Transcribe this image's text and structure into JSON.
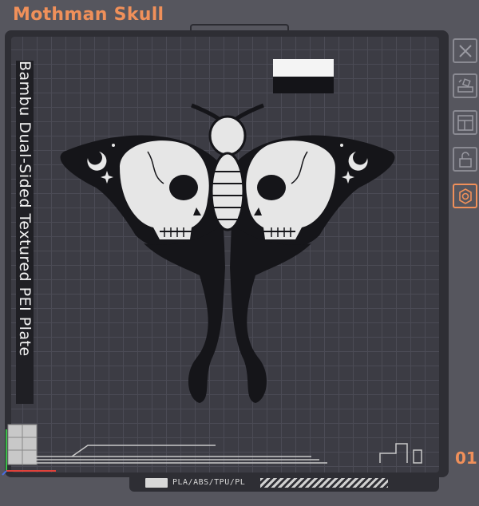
{
  "header": {
    "title": "Mothman Skull"
  },
  "plate": {
    "label": "Bambu Dual-Sided Textured PEI Plate",
    "number": "01",
    "filament_types": "PLA/ABS/TPU/PL"
  },
  "toolbar": {
    "buttons": [
      {
        "name": "close-plate-button",
        "icon": "close-icon"
      },
      {
        "name": "auto-arrange-button",
        "icon": "auto-arrange-icon"
      },
      {
        "name": "layout-button",
        "icon": "layout-icon"
      },
      {
        "name": "lock-button",
        "icon": "lock-icon"
      },
      {
        "name": "plate-settings-button",
        "icon": "gear-icon"
      }
    ]
  },
  "colors": {
    "accent": "#f0905a",
    "plate_bg": "#3c3c44",
    "frame": "#2e2e34",
    "page_bg": "#56565e"
  }
}
